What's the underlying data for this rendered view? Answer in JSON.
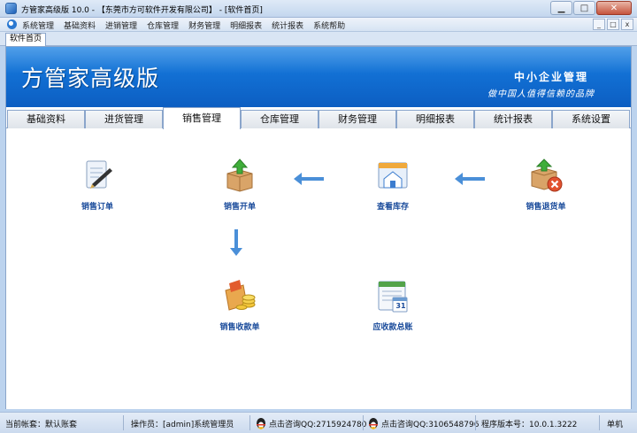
{
  "window": {
    "title": "方管家高级版 10.0 - 【东莞市方可软件开发有限公司】 - [软件首页]",
    "minimize_glyph": "▁",
    "maximize_glyph": "□",
    "close_glyph": "✕"
  },
  "menu": {
    "items": [
      "系统管理",
      "基础资料",
      "进销管理",
      "仓库管理",
      "财务管理",
      "明细报表",
      "统计报表",
      "系统帮助"
    ],
    "mdi_minimize": "_",
    "mdi_restore": "□",
    "mdi_close": "x"
  },
  "doc_tab": "软件首页",
  "banner": {
    "brand": "方管家高级版",
    "slogan1": "中小企业管理",
    "slogan2": "做中国人值得信赖的品牌"
  },
  "module_tabs": [
    "基础资料",
    "进货管理",
    "销售管理",
    "仓库管理",
    "财务管理",
    "明细报表",
    "统计报表",
    "系统设置"
  ],
  "active_module_tab": "销售管理",
  "flow": {
    "nodes": {
      "sales_order": "销售订单",
      "sales_invoice": "销售开单",
      "stock_query": "查看库存",
      "sales_return": "销售退货单",
      "sales_receipt": "销售收款单",
      "receivables_ledger": "应收款总账"
    },
    "calendar_day": "31"
  },
  "status": {
    "account": "当前帐套：默认账套",
    "operator": "操作员：[admin]系统管理员",
    "qq1": "点击咨询QQ:2715924780",
    "qq2": "点击咨询QQ:3106548796",
    "version": "程序版本号：10.0.1.3222",
    "mode": "单机"
  },
  "colors": {
    "banner_blue": "#1270d4",
    "node_label": "#1a4b9b",
    "arrow": "#4a8fd8"
  }
}
